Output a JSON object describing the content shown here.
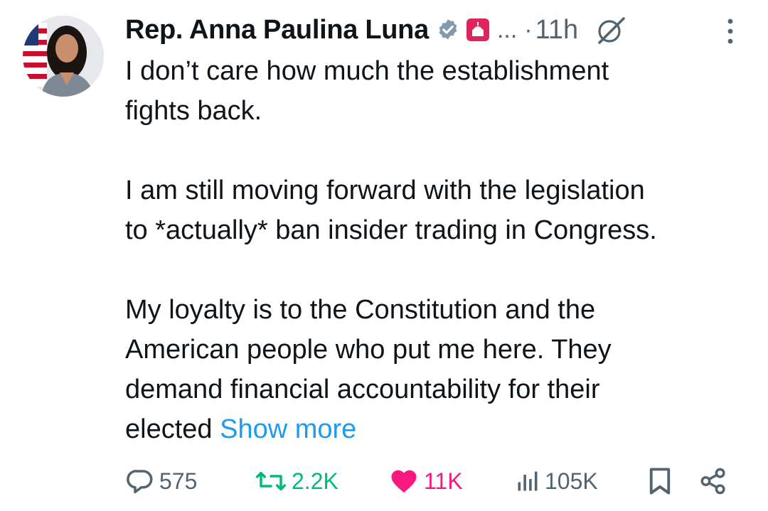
{
  "author": {
    "name": "Rep. Anna Paulina Luna",
    "handle": "...",
    "separator": "·",
    "time": "11h"
  },
  "tweet": {
    "paragraphs": [
      [
        "I don’t care how much the establishment",
        "fights back."
      ],
      [
        "I am still moving forward with the legislation",
        "to *actually* ban insider trading in Congress."
      ],
      [
        "My loyalty is to the Constitution and the",
        "American people who put me here. They",
        "demand financial accountability for their"
      ]
    ],
    "last_line_prefix": "elected ",
    "show_more": "Show more"
  },
  "actions": {
    "replies": "575",
    "reposts": "2.2K",
    "likes": "11K",
    "views": "105K"
  },
  "colors": {
    "text": "#0f1419",
    "secondary": "#536471",
    "link": "#1d9bf0",
    "repost": "#00ba7c",
    "like": "#f91880",
    "verified_badge": "#829aab",
    "affiliation_badge": "#e0245e"
  },
  "icons": [
    "verified-badge-icon",
    "affiliation-badge-icon",
    "grok-icon",
    "more-options-icon",
    "reply-icon",
    "repost-icon",
    "like-icon",
    "views-icon",
    "bookmark-icon",
    "share-icon"
  ]
}
